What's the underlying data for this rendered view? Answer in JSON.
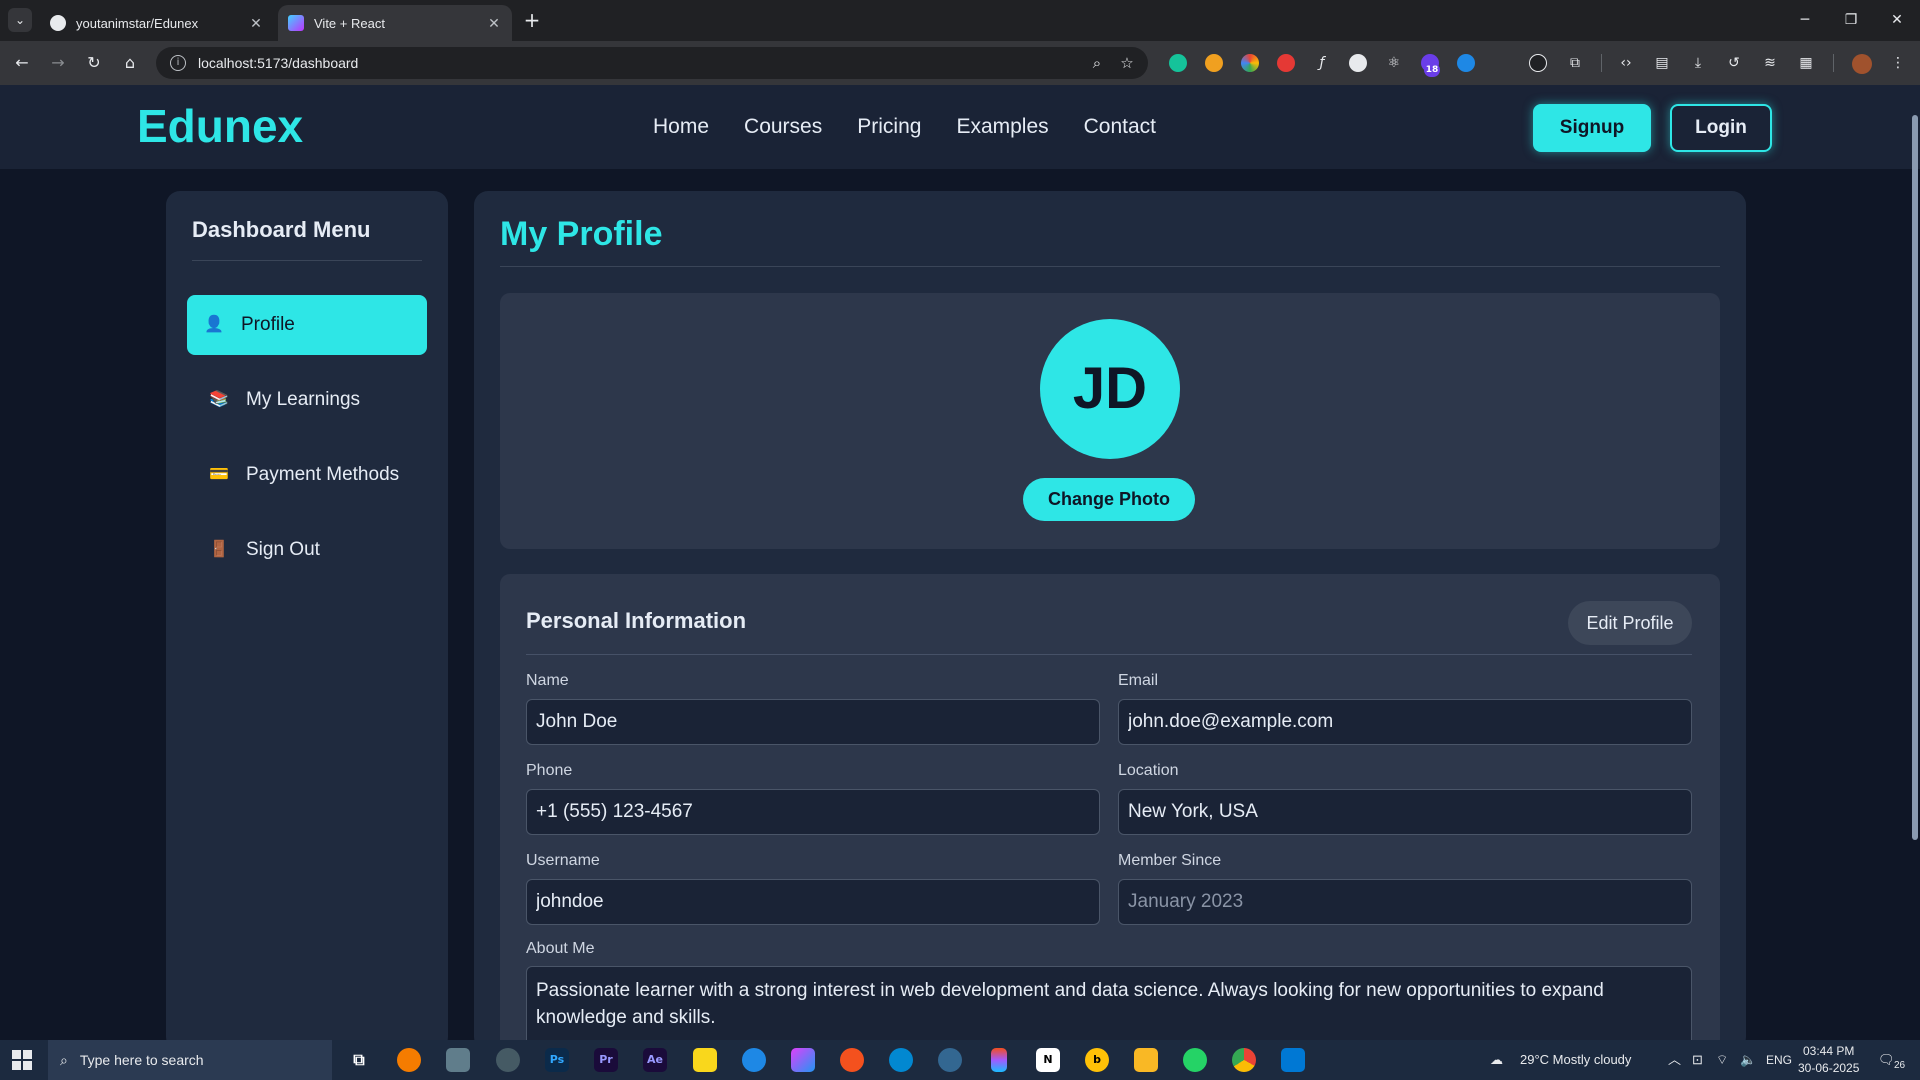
{
  "browser": {
    "tabs": [
      {
        "title": "youtanimstar/Edunex"
      },
      {
        "title": "Vite + React"
      }
    ],
    "url": "localhost:5173/dashboard",
    "extension_badge": "18"
  },
  "site": {
    "brand": "Edunex",
    "nav": [
      "Home",
      "Courses",
      "Pricing",
      "Examples",
      "Contact"
    ],
    "signup": "Signup",
    "login": "Login"
  },
  "sidebar": {
    "title": "Dashboard Menu",
    "items": [
      {
        "label": "Profile",
        "icon": "profile-icon"
      },
      {
        "label": "My Learnings",
        "icon": "books-icon"
      },
      {
        "label": "Payment Methods",
        "icon": "credit-card-icon"
      },
      {
        "label": "Sign Out",
        "icon": "door-icon"
      }
    ]
  },
  "profile": {
    "title": "My Profile",
    "initials": "JD",
    "change_photo": "Change Photo",
    "section_title": "Personal Information",
    "edit": "Edit Profile",
    "fields": {
      "name": {
        "label": "Name",
        "value": "John Doe"
      },
      "email": {
        "label": "Email",
        "value": "john.doe@example.com"
      },
      "phone": {
        "label": "Phone",
        "value": "+1 (555) 123-4567"
      },
      "location": {
        "label": "Location",
        "value": "New York, USA"
      },
      "username": {
        "label": "Username",
        "value": "johndoe"
      },
      "member_since": {
        "label": "Member Since",
        "value": "January 2023"
      },
      "about": {
        "label": "About Me",
        "value": "Passionate learner with a strong interest in web development and data science. Always looking for new opportunities to expand knowledge and skills."
      }
    }
  },
  "taskbar": {
    "search_placeholder": "Type here to search",
    "weather": "29°C  Mostly cloudy",
    "lang": "ENG",
    "time": "03:44 PM",
    "date": "30-06-2025",
    "notifications": "26"
  },
  "colors": {
    "accent": "#2ee6e6",
    "page_bg": "#0f1626",
    "panel_bg": "#1f2a3e",
    "card_bg": "#2d374b"
  }
}
